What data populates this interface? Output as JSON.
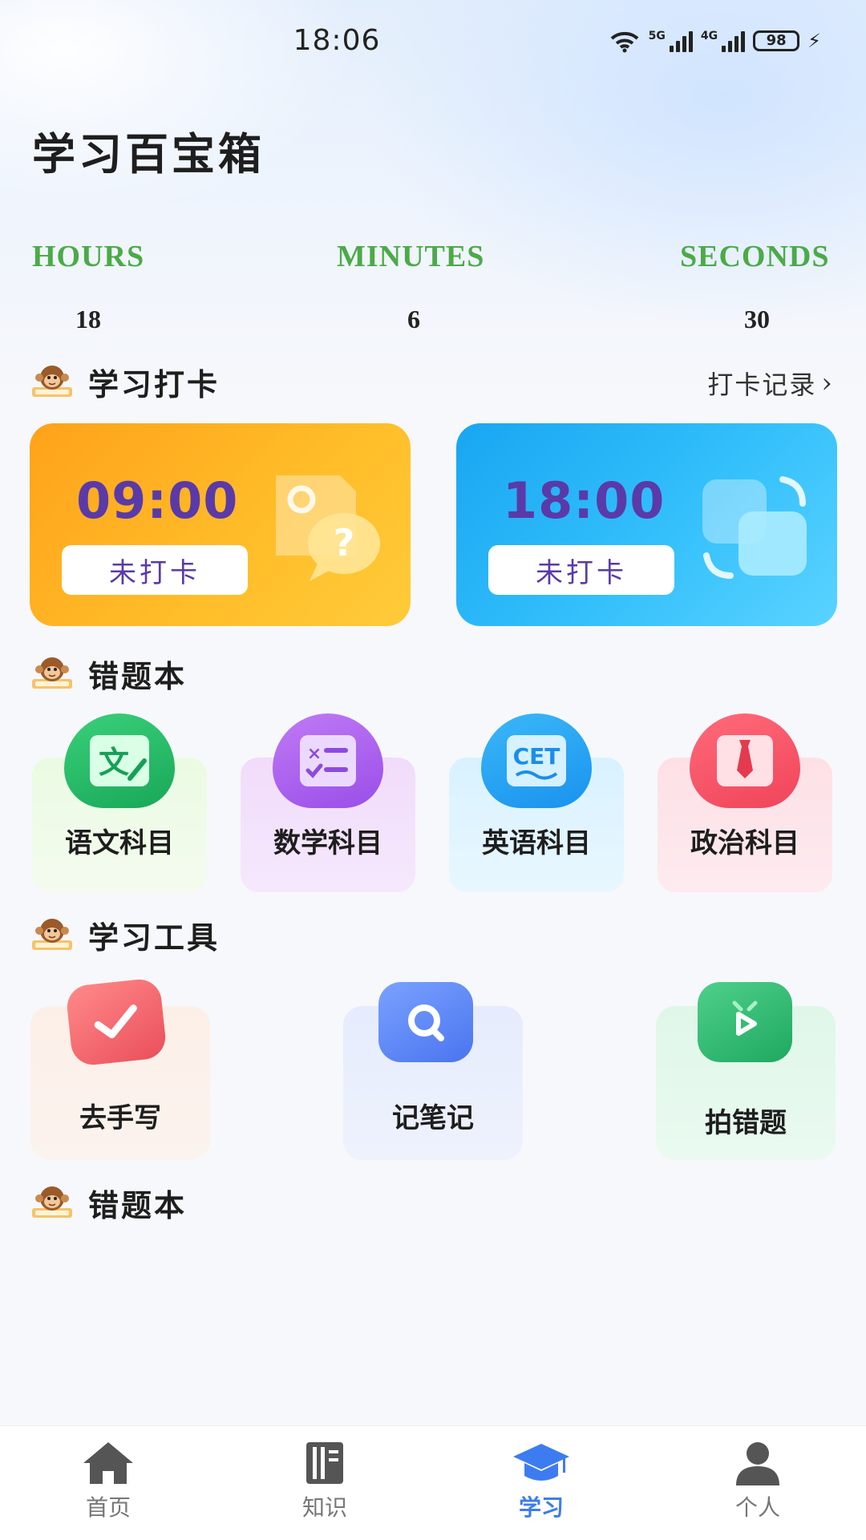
{
  "status_bar": {
    "time": "18:06",
    "net_tag_1": "5G",
    "net_tag_2": "4G",
    "battery": "98"
  },
  "app": {
    "title": "学习百宝箱"
  },
  "timer": {
    "hours_label": "HOURS",
    "minutes_label": "MINUTES",
    "seconds_label": "SECONDS",
    "hours": "18",
    "minutes": "6",
    "seconds": "30"
  },
  "checkin": {
    "title": "学习打卡",
    "record_link": "打卡记录",
    "cards": [
      {
        "time": "09:00",
        "status": "未打卡"
      },
      {
        "time": "18:00",
        "status": "未打卡"
      }
    ]
  },
  "mistakes": {
    "title": "错题本",
    "subjects": [
      {
        "label": "语文科目",
        "icon": "chinese-text-icon",
        "icon_text": "文"
      },
      {
        "label": "数学科目",
        "icon": "math-list-icon"
      },
      {
        "label": "英语科目",
        "icon": "cet-icon",
        "icon_text": "CET"
      },
      {
        "label": "政治科目",
        "icon": "tie-icon"
      }
    ]
  },
  "tools": {
    "title": "学习工具",
    "items": [
      {
        "label": "去手写",
        "icon": "checkmark-icon"
      },
      {
        "label": "记笔记",
        "icon": "search-note-icon"
      },
      {
        "label": "拍错题",
        "icon": "play-tv-icon"
      }
    ]
  },
  "mistakes_section_2": {
    "title": "错题本"
  },
  "bottom_nav": [
    {
      "label": "首页",
      "icon": "home-icon",
      "active": false
    },
    {
      "label": "知识",
      "icon": "book-icon",
      "active": false
    },
    {
      "label": "学习",
      "icon": "graduation-cap-icon",
      "active": true
    },
    {
      "label": "个人",
      "icon": "person-icon",
      "active": false
    }
  ],
  "colors": {
    "accent_green": "#4caa48",
    "accent_purple": "#5a3aa8",
    "nav_active": "#3d7cf0"
  }
}
